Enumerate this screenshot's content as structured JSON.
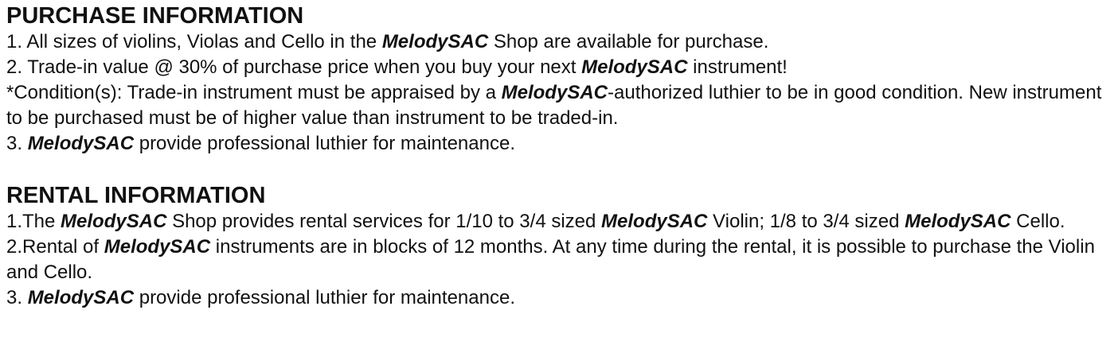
{
  "purchase": {
    "heading": "PURCHASE INFORMATION",
    "lines": [
      [
        {
          "t": "1. All sizes of violins, Violas and Cello in the ",
          "brand": false
        },
        {
          "t": "MelodySAC",
          "brand": true
        },
        {
          "t": " Shop are available for purchase.",
          "brand": false
        }
      ],
      [
        {
          "t": "2. Trade-in value @ 30% of purchase price when you buy your next ",
          "brand": false
        },
        {
          "t": "MelodySAC",
          "brand": true
        },
        {
          "t": " instrument!",
          "brand": false
        }
      ],
      [
        {
          "t": "*Condition(s): Trade-in instrument must be appraised by a ",
          "brand": false
        },
        {
          "t": "MelodySAC",
          "brand": true
        },
        {
          "t": "-authorized luthier to be in good condition. New instrument to be purchased must be of higher value than instrument to be traded-in.",
          "brand": false
        }
      ],
      [
        {
          "t": "3. ",
          "brand": false
        },
        {
          "t": "MelodySAC",
          "brand": true
        },
        {
          "t": " provide professional luthier for maintenance.",
          "brand": false
        }
      ]
    ]
  },
  "rental": {
    "heading": "RENTAL INFORMATION",
    "lines": [
      [
        {
          "t": "1.The ",
          "brand": false
        },
        {
          "t": "MelodySAC",
          "brand": true
        },
        {
          "t": " Shop provides rental services for 1/10 to 3/4 sized ",
          "brand": false
        },
        {
          "t": "MelodySAC",
          "brand": true
        },
        {
          "t": " Violin; 1/8 to 3/4 sized ",
          "brand": false
        },
        {
          "t": "MelodySAC",
          "brand": true
        },
        {
          "t": " Cello.",
          "brand": false
        }
      ],
      [
        {
          "t": "2.Rental of ",
          "brand": false
        },
        {
          "t": "MelodySAC",
          "brand": true
        },
        {
          "t": " instruments are in blocks of 12 months. At any time during the rental, it is possible to purchase the Violin and Cello.",
          "brand": false
        }
      ],
      [
        {
          "t": "3. ",
          "brand": false
        },
        {
          "t": "MelodySAC",
          "brand": true
        },
        {
          "t": " provide professional luthier for maintenance.",
          "brand": false
        }
      ]
    ]
  }
}
